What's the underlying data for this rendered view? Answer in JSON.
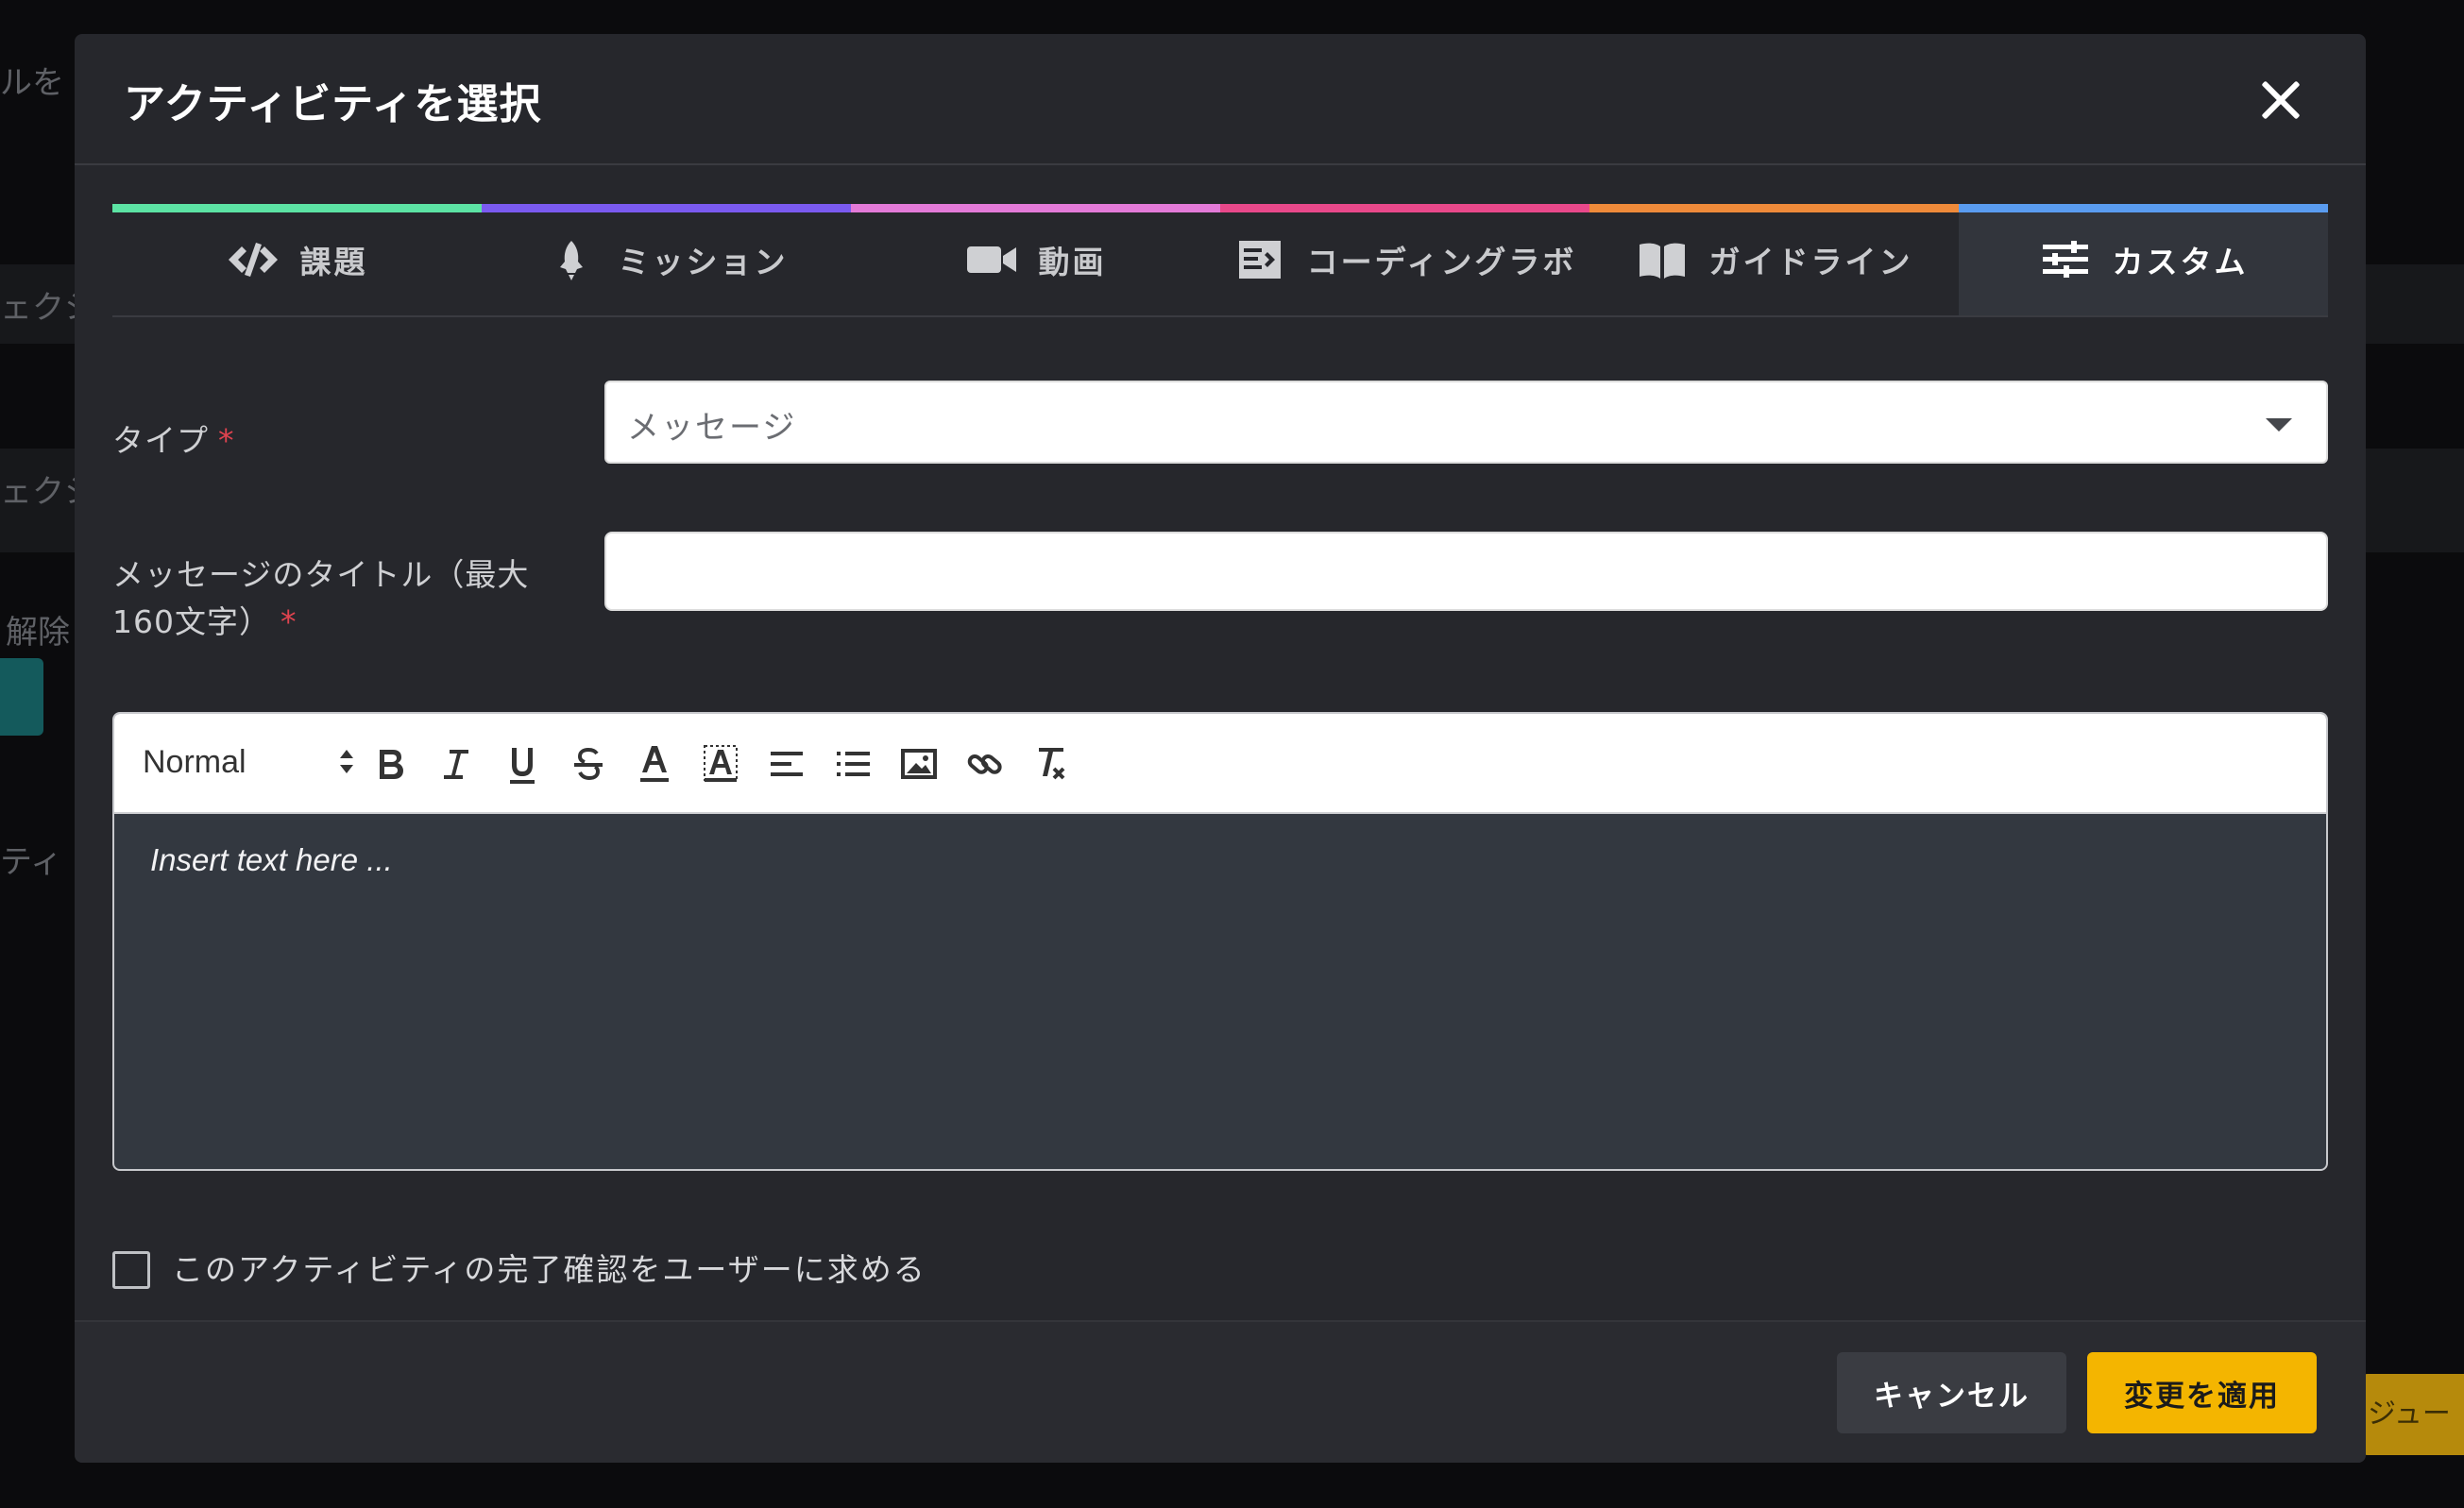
{
  "background": {
    "fragments": [
      "ルを",
      "ェクシ",
      "ェクシ",
      "解除",
      "ティ",
      "ジュー"
    ]
  },
  "modal": {
    "title": "アクティビティを選択",
    "close_icon": "close-icon"
  },
  "tabs": [
    {
      "label": "課題",
      "icon": "code-icon",
      "color": "#5ce3a4"
    },
    {
      "label": "ミッション",
      "icon": "rocket-icon",
      "color": "#7a5af0"
    },
    {
      "label": "動画",
      "icon": "video-icon",
      "color": "#e37ad8"
    },
    {
      "label": "コーディングラボ",
      "icon": "coding-lab-icon",
      "color": "#e8488a"
    },
    {
      "label": "ガイドライン",
      "icon": "book-icon",
      "color": "#ee8a3a"
    },
    {
      "label": "カスタム",
      "icon": "sliders-icon",
      "color": "#5a9cf0",
      "active": true
    }
  ],
  "form": {
    "type_label": "タイプ",
    "type_value": "メッセージ",
    "title_label_line1": "メッセージのタイトル（最大",
    "title_label_line2": "160文字）",
    "title_value": "",
    "required_mark": "*"
  },
  "editor": {
    "format_value": "Normal",
    "placeholder": "Insert text here ...",
    "tools": [
      "bold-icon",
      "italic-icon",
      "underline-icon",
      "strike-icon",
      "text-color-icon",
      "background-color-icon",
      "align-icon",
      "list-icon",
      "image-icon",
      "link-icon",
      "clear-format-icon"
    ]
  },
  "checkbox": {
    "label": "このアクティビティの完了確認をユーザーに求める",
    "checked": false
  },
  "footer": {
    "cancel_label": "キャンセル",
    "apply_label": "変更を適用",
    "apply_color": "#f4b500"
  }
}
